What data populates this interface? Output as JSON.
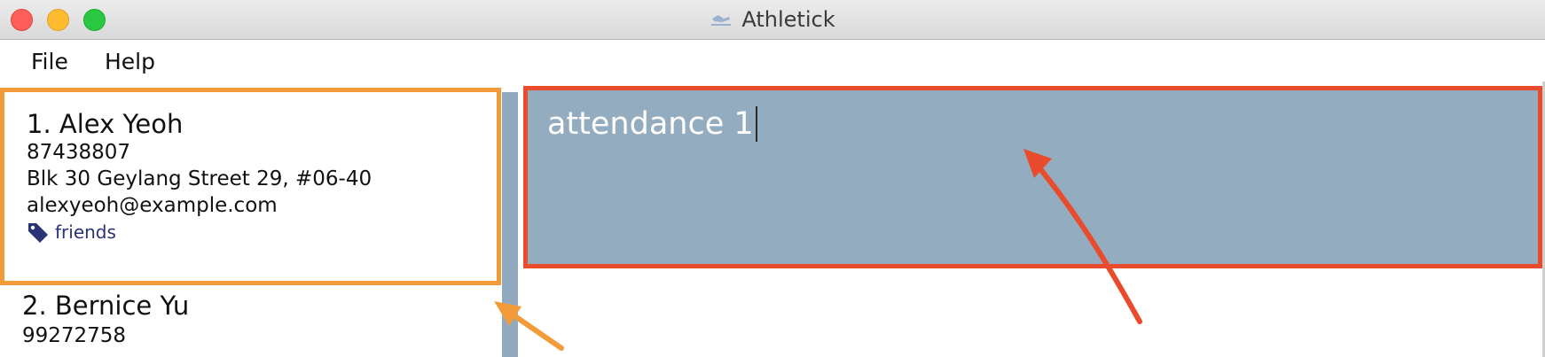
{
  "window": {
    "title": "Athletick"
  },
  "menu": {
    "file_label": "File",
    "help_label": "Help"
  },
  "persons": [
    {
      "index_name": "1.  Alex Yeoh",
      "phone": "87438807",
      "address": "Blk 30 Geylang Street 29, #06-40",
      "email": "alexyeoh@example.com",
      "tags": [
        "friends"
      ]
    },
    {
      "index_name": "2.  Bernice Yu",
      "phone": "99272758"
    }
  ],
  "result_display": {
    "text": "attendance 1"
  },
  "colors": {
    "highlight_orange": "#f29b38",
    "highlight_red": "#e94c2c",
    "result_background": "#94acc0",
    "tag_color": "#2a3276"
  }
}
